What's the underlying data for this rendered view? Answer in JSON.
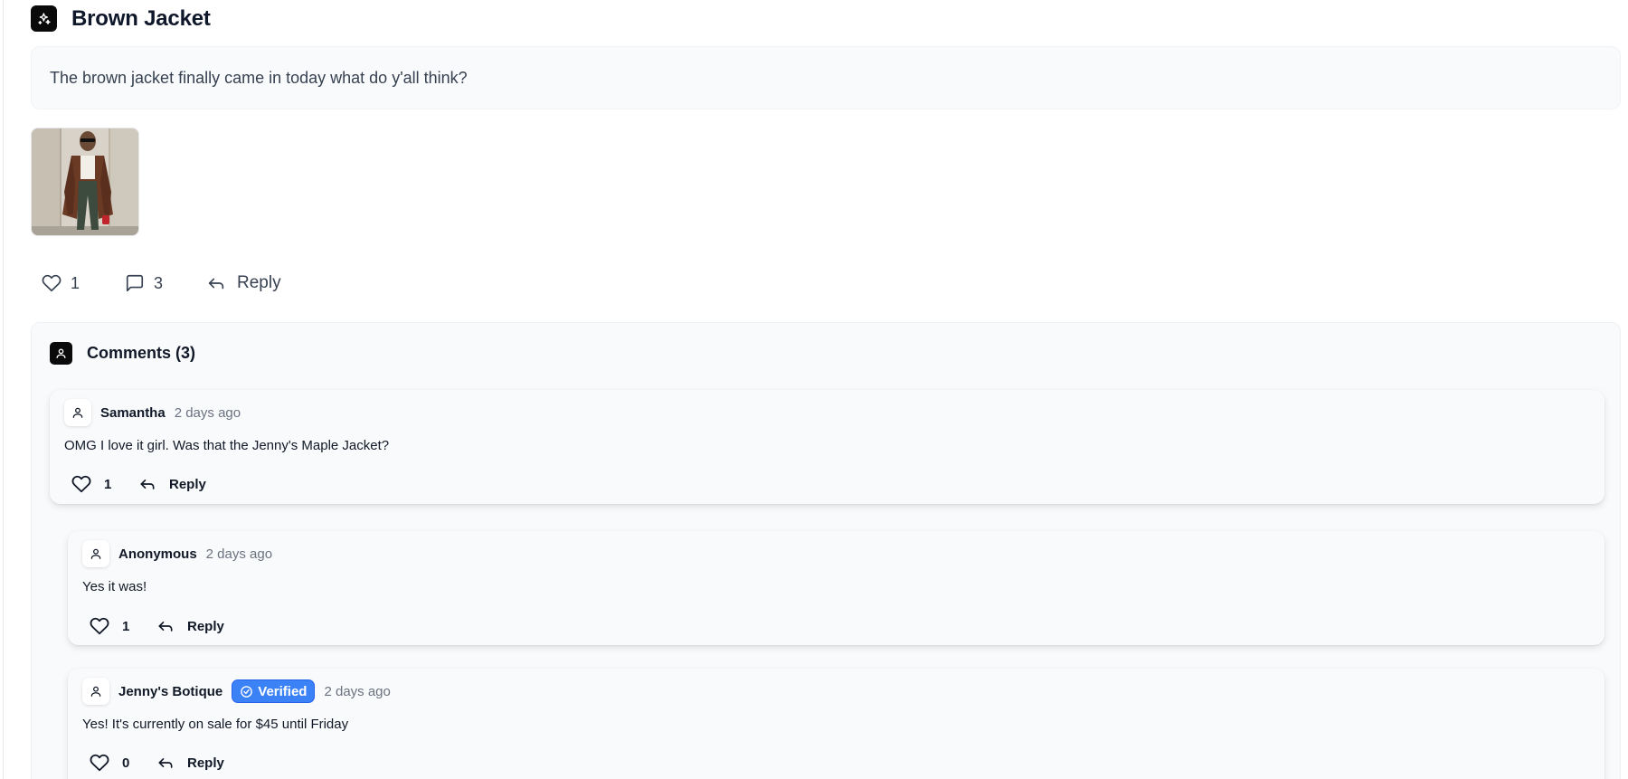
{
  "post": {
    "title": "Brown Jacket",
    "body": "The brown jacket finally came in today what do y'all think?",
    "header_icon": "sparkle-icon",
    "image_alt": "Woman in brown leather jacket and green cargo pants",
    "likes": "1",
    "comments_count": "3",
    "reply_label": "Reply"
  },
  "comments": {
    "title": "Comments (3)",
    "items": [
      {
        "author": "Samantha",
        "time": "2 days ago",
        "text": "OMG I love it girl. Was that the Jenny's Maple Jacket?",
        "likes": "1",
        "reply_label": "Reply"
      },
      {
        "author": "Anonymous",
        "time": "2 days ago",
        "text": "Yes it was!",
        "likes": "1",
        "reply_label": "Reply"
      },
      {
        "author": "Jenny's Botique",
        "verified": "Verified",
        "time": "2 days ago",
        "text": "Yes! It's currently on sale for $45 until Friday",
        "likes": "0",
        "reply_label": "Reply"
      }
    ]
  },
  "colors": {
    "accent": "#3b82f6",
    "panel_bg": "#f8fafc",
    "text_muted": "#6b7280"
  }
}
